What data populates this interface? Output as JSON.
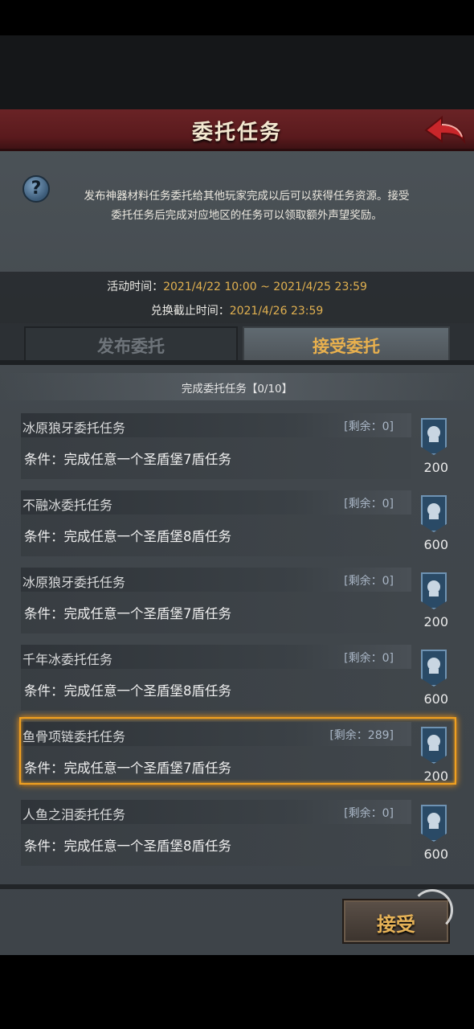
{
  "header": {
    "title": "委托任务"
  },
  "description": {
    "line1": "发布神器材料任务委托给其他玩家完成以后可以获得任务资源。接受",
    "line2": "委托任务后完成对应地区的任务可以领取额外声望奖励。"
  },
  "times": {
    "activity_label": "活动时间：",
    "activity_value": "2021/4/22 10:00 ~ 2021/4/25 23:59",
    "deadline_label": "兑换截止时间：",
    "deadline_value": "2021/4/26 23:59"
  },
  "tabs": [
    {
      "label": "发布委托",
      "active": false
    },
    {
      "label": "接受委托",
      "active": true
    }
  ],
  "progress": "完成委托任务【0/10】",
  "tasks": [
    {
      "name": "冰原狼牙委托任务",
      "remain": "[剩余：0]",
      "condition": "条件：完成任意一个圣盾堡7盾任务",
      "reward": "200",
      "selected": false
    },
    {
      "name": "不融冰委托任务",
      "remain": "[剩余：0]",
      "condition": "条件：完成任意一个圣盾堡8盾任务",
      "reward": "600",
      "selected": false
    },
    {
      "name": "冰原狼牙委托任务",
      "remain": "[剩余：0]",
      "condition": "条件：完成任意一个圣盾堡7盾任务",
      "reward": "200",
      "selected": false
    },
    {
      "name": "千年冰委托任务",
      "remain": "[剩余：0]",
      "condition": "条件：完成任意一个圣盾堡8盾任务",
      "reward": "600",
      "selected": false
    },
    {
      "name": "鱼骨项链委托任务",
      "remain": "[剩余：289]",
      "condition": "条件：完成任意一个圣盾堡7盾任务",
      "reward": "200",
      "selected": true
    },
    {
      "name": "人鱼之泪委托任务",
      "remain": "[剩余：0]",
      "condition": "条件：完成任意一个圣盾堡8盾任务",
      "reward": "600",
      "selected": false
    }
  ],
  "accept_button": "接受",
  "icons": {
    "back": "back-arrow-icon",
    "help": "help-icon",
    "reward": "reputation-badge-icon"
  },
  "colors": {
    "accent": "#e0b050",
    "header_red": "#6a2326",
    "highlight": "#f0a020"
  }
}
